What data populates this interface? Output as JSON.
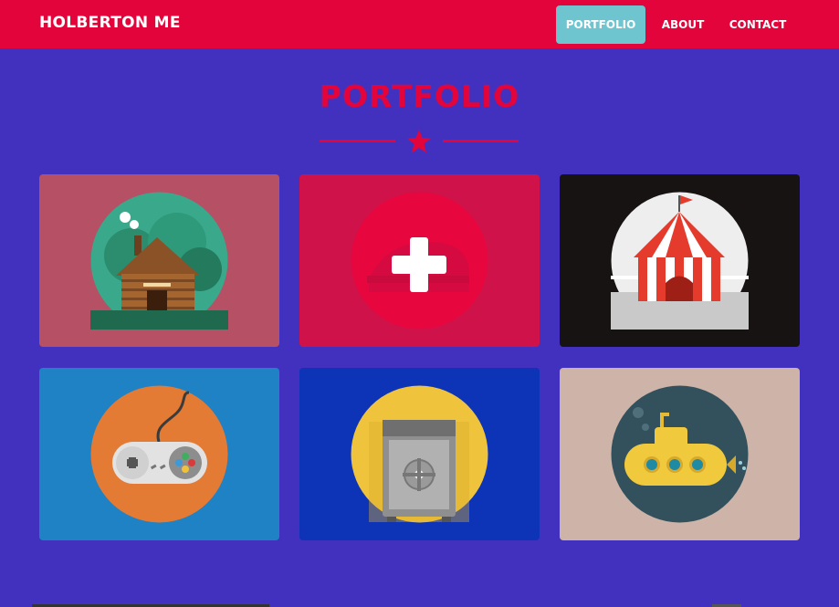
{
  "navbar": {
    "brand": "HOLBERTON ME",
    "links": [
      {
        "label": "PORTFOLIO",
        "active": true
      },
      {
        "label": "ABOUT",
        "active": false
      },
      {
        "label": "CONTACT",
        "active": false
      }
    ],
    "background": "#e2043a",
    "active_color": "#6ec4cf"
  },
  "section": {
    "title": "PORTFOLIO",
    "divider_icon": "star-icon"
  },
  "portfolio": {
    "items": [
      {
        "icon": "log-cabin-icon",
        "background": "#b55065"
      },
      {
        "icon": "plus-overlay-icon",
        "background": "#d0124a"
      },
      {
        "icon": "circus-tent-icon",
        "background": "#161312"
      },
      {
        "icon": "game-controller-icon",
        "background": "#1e82c4"
      },
      {
        "icon": "safe-icon",
        "background": "#0d33b6"
      },
      {
        "icon": "submarine-icon",
        "background": "#cdb3a8"
      }
    ]
  },
  "colors": {
    "page_background": "#4231bf",
    "accent": "#e2043a"
  }
}
